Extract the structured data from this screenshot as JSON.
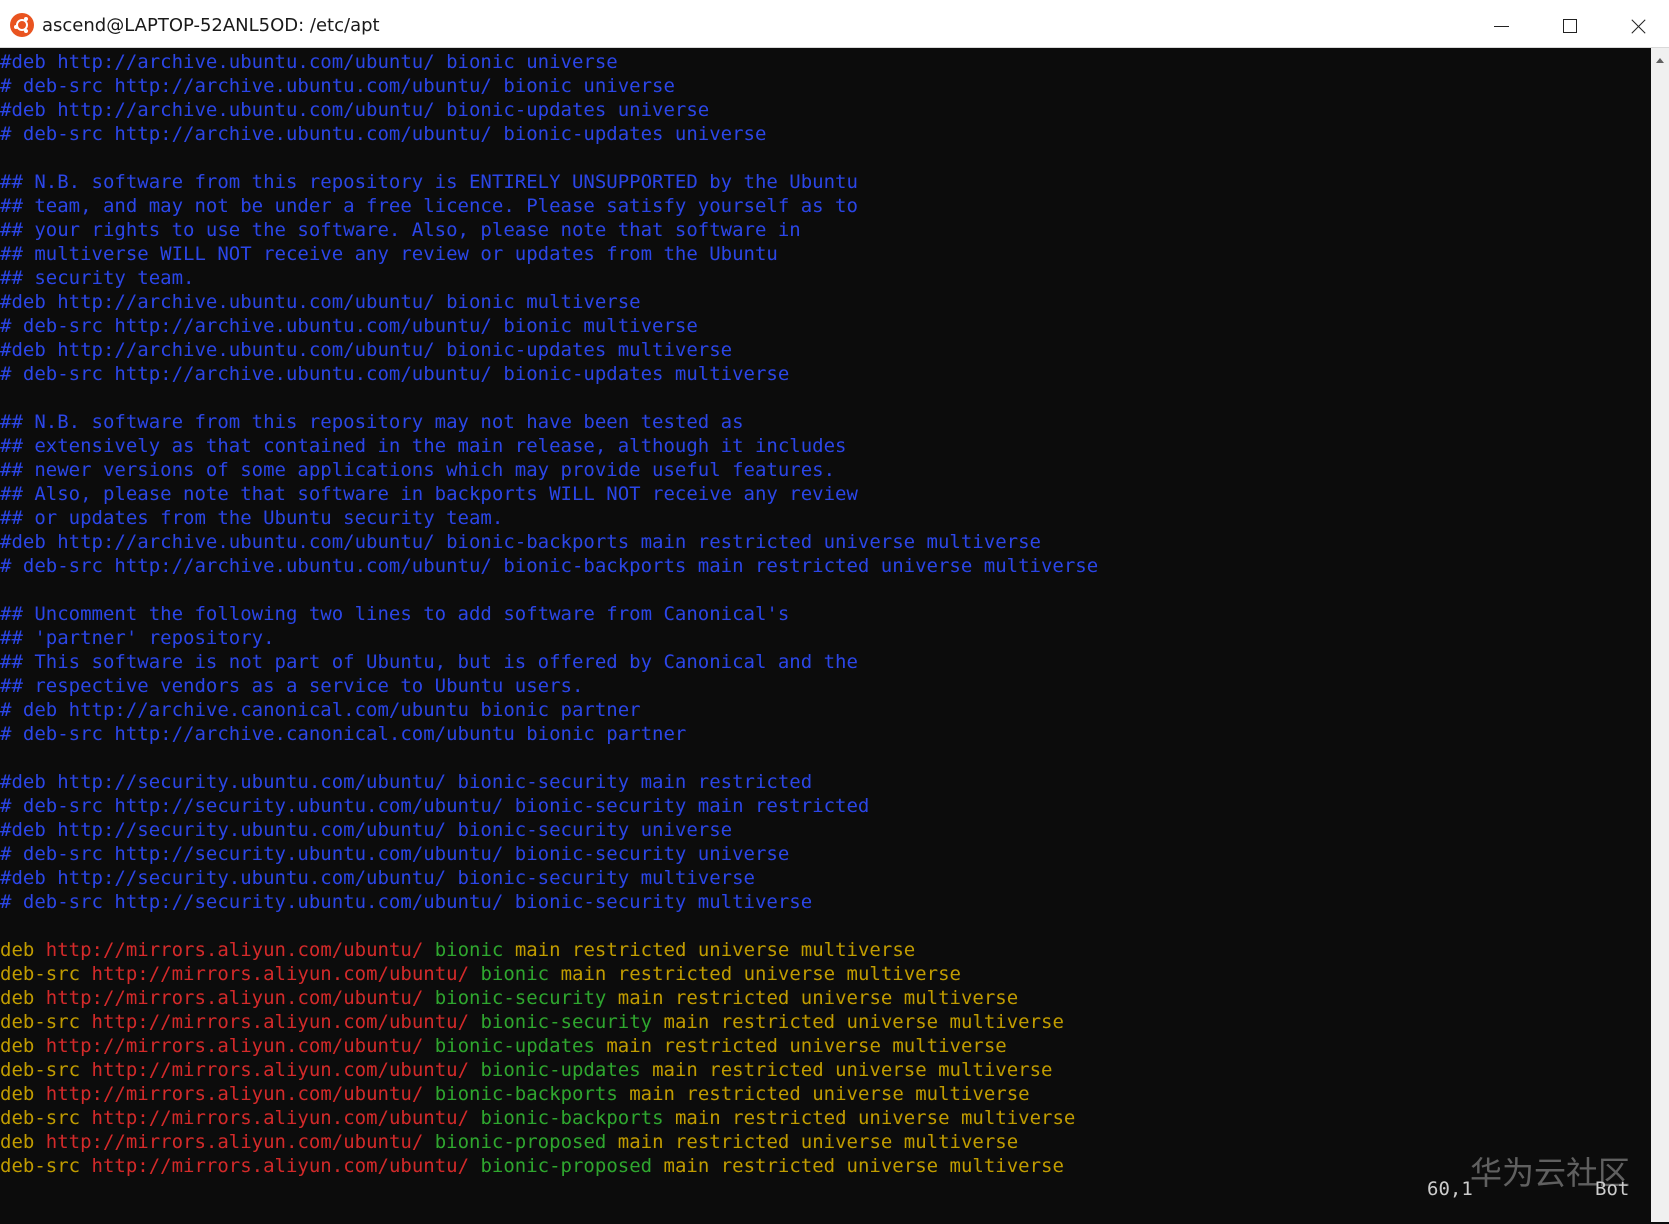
{
  "window": {
    "title": "ascend@LAPTOP-52ANL5OD: /etc/apt",
    "icon": "ubuntu-icon",
    "controls": [
      "minimize-icon",
      "maximize-icon",
      "close-icon"
    ]
  },
  "colors": {
    "background": "#0c0c0c",
    "comment": "#2b46e8",
    "keyword": "#c19c00",
    "url": "#d42a2a",
    "distribution": "#2fa72f",
    "component": "#c19c00"
  },
  "comment_lines": [
    "#deb http://archive.ubuntu.com/ubuntu/ bionic universe",
    "# deb-src http://archive.ubuntu.com/ubuntu/ bionic universe",
    "#deb http://archive.ubuntu.com/ubuntu/ bionic-updates universe",
    "# deb-src http://archive.ubuntu.com/ubuntu/ bionic-updates universe",
    "",
    "## N.B. software from this repository is ENTIRELY UNSUPPORTED by the Ubuntu",
    "## team, and may not be under a free licence. Please satisfy yourself as to",
    "## your rights to use the software. Also, please note that software in",
    "## multiverse WILL NOT receive any review or updates from the Ubuntu",
    "## security team.",
    "#deb http://archive.ubuntu.com/ubuntu/ bionic multiverse",
    "# deb-src http://archive.ubuntu.com/ubuntu/ bionic multiverse",
    "#deb http://archive.ubuntu.com/ubuntu/ bionic-updates multiverse",
    "# deb-src http://archive.ubuntu.com/ubuntu/ bionic-updates multiverse",
    "",
    "## N.B. software from this repository may not have been tested as",
    "## extensively as that contained in the main release, although it includes",
    "## newer versions of some applications which may provide useful features.",
    "## Also, please note that software in backports WILL NOT receive any review",
    "## or updates from the Ubuntu security team.",
    "#deb http://archive.ubuntu.com/ubuntu/ bionic-backports main restricted universe multiverse",
    "# deb-src http://archive.ubuntu.com/ubuntu/ bionic-backports main restricted universe multiverse",
    "",
    "## Uncomment the following two lines to add software from Canonical's",
    "## 'partner' repository.",
    "## This software is not part of Ubuntu, but is offered by Canonical and the",
    "## respective vendors as a service to Ubuntu users.",
    "# deb http://archive.canonical.com/ubuntu bionic partner",
    "# deb-src http://archive.canonical.com/ubuntu bionic partner",
    "",
    "#deb http://security.ubuntu.com/ubuntu/ bionic-security main restricted",
    "# deb-src http://security.ubuntu.com/ubuntu/ bionic-security main restricted",
    "#deb http://security.ubuntu.com/ubuntu/ bionic-security universe",
    "# deb-src http://security.ubuntu.com/ubuntu/ bionic-security universe",
    "#deb http://security.ubuntu.com/ubuntu/ bionic-security multiverse",
    "# deb-src http://security.ubuntu.com/ubuntu/ bionic-security multiverse",
    ""
  ],
  "source_lines": [
    {
      "type": "deb",
      "url": "http://mirrors.aliyun.com/ubuntu/",
      "dist": "bionic",
      "components": "main restricted universe multiverse"
    },
    {
      "type": "deb-src",
      "url": "http://mirrors.aliyun.com/ubuntu/",
      "dist": "bionic",
      "components": "main restricted universe multiverse"
    },
    {
      "type": "deb",
      "url": "http://mirrors.aliyun.com/ubuntu/",
      "dist": "bionic-security",
      "components": "main restricted universe multiverse"
    },
    {
      "type": "deb-src",
      "url": "http://mirrors.aliyun.com/ubuntu/",
      "dist": "bionic-security",
      "components": "main restricted universe multiverse"
    },
    {
      "type": "deb",
      "url": "http://mirrors.aliyun.com/ubuntu/",
      "dist": "bionic-updates",
      "components": "main restricted universe multiverse"
    },
    {
      "type": "deb-src",
      "url": "http://mirrors.aliyun.com/ubuntu/",
      "dist": "bionic-updates",
      "components": "main restricted universe multiverse"
    },
    {
      "type": "deb",
      "url": "http://mirrors.aliyun.com/ubuntu/",
      "dist": "bionic-backports",
      "components": "main restricted universe multiverse"
    },
    {
      "type": "deb-src",
      "url": "http://mirrors.aliyun.com/ubuntu/",
      "dist": "bionic-backports",
      "components": "main restricted universe multiverse"
    },
    {
      "type": "deb",
      "url": "http://mirrors.aliyun.com/ubuntu/",
      "dist": "bionic-proposed",
      "components": "main restricted universe multiverse"
    },
    {
      "type": "deb-src",
      "url": "http://mirrors.aliyun.com/ubuntu/",
      "dist": "bionic-proposed",
      "components": "main restricted universe multiverse"
    }
  ],
  "status": {
    "position": "60,1",
    "scroll": "Bot"
  },
  "watermark": "华为云社区"
}
